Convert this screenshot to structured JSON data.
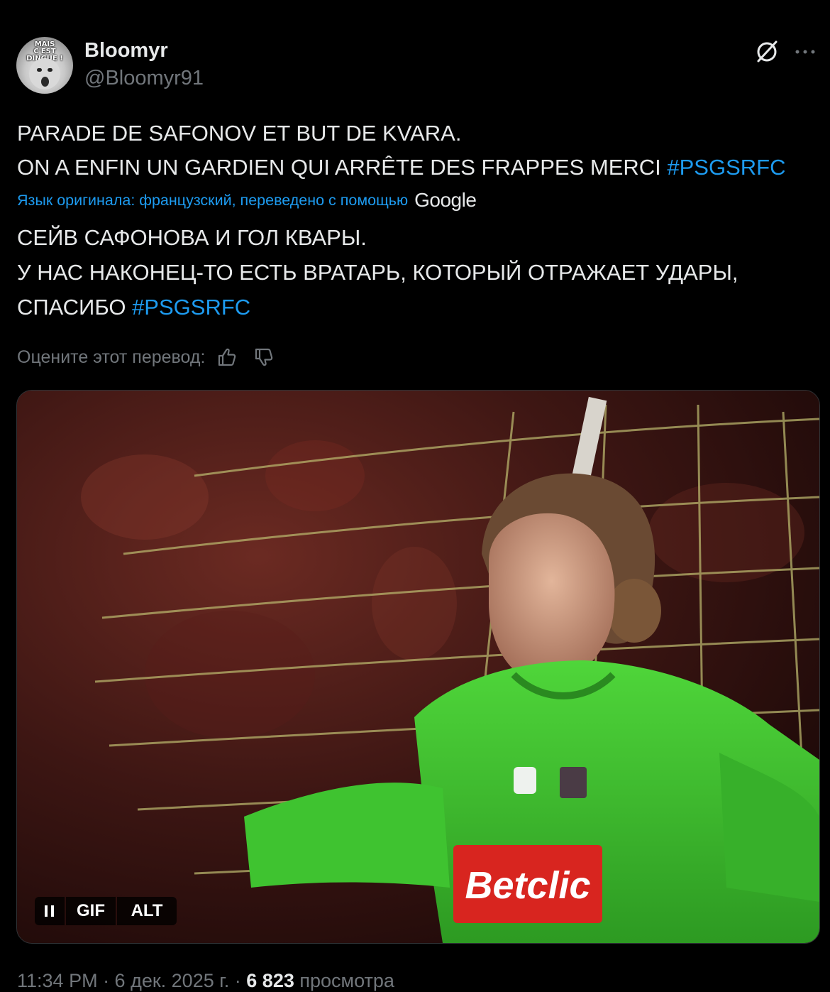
{
  "author": {
    "name": "Bloomyr",
    "handle": "@Bloomyr91",
    "avatar_text": "MAIS C'EST DINGUE !"
  },
  "header_icons": [
    "grok-icon",
    "more-icon"
  ],
  "tweet": {
    "line1": "PARADE DE SAFONOV ET BUT DE KVARA.",
    "line2_text": "ON A ENFIN UN GARDIEN QUI ARRÊTE DES FRAPPES MERCI ",
    "hashtag": "#PSGSRFC"
  },
  "translation_notice": {
    "label": "Язык оригинала: французский, переведено с помощью",
    "provider": "Google"
  },
  "translation": {
    "line1": "СЕЙВ САФОНОВА И ГОЛ КВАРЫ.",
    "line2": "У НАС НАКОНЕЦ-ТО ЕСТЬ ВРАТАРЬ, КОТОРЫЙ ОТРАЖАЕТ УДАРЫ,",
    "line3_text": "СПАСИБО ",
    "hashtag": "#PSGSRFC"
  },
  "rate_translation": {
    "label": "Оцените этот перевод:",
    "icons": [
      "thumbs-up-icon",
      "thumbs-down-icon"
    ]
  },
  "media": {
    "type": "GIF",
    "gif_label": "GIF",
    "alt_label": "ALT",
    "sponsor_text": "Betclic",
    "controls_icon": "pause-icon"
  },
  "meta": {
    "time_date": "11:34 PM · 6 дек. 2025 г. · ",
    "views": "6 823",
    "views_label": " просмотра"
  },
  "colors": {
    "background": "#000000",
    "text": "#e7e9ea",
    "secondary": "#71767b",
    "accent": "#1d9bf0"
  }
}
